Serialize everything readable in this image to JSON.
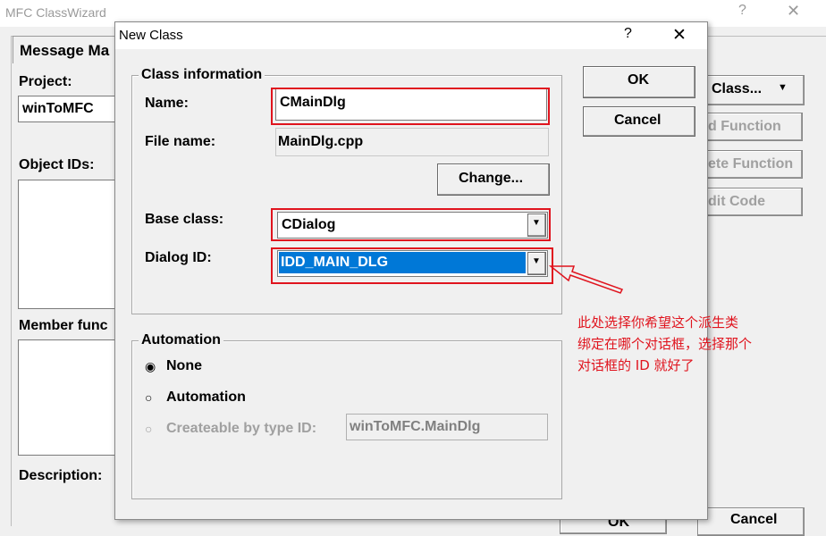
{
  "background_window": {
    "title": "MFC ClassWizard",
    "help_icon": "?",
    "close_icon": "✕",
    "tab_label": "Message Ma",
    "project_label": "Project:",
    "project_value": "winToMFC",
    "object_ids_label": "Object IDs:",
    "member_functions_label": "Member func",
    "description_label": "Description:",
    "buttons": {
      "class": "Class...",
      "add_function": "d Function",
      "delete_function": "ete Function",
      "edit_code": "dit Code",
      "ok": "OK",
      "cancel": "Cancel"
    }
  },
  "dialog": {
    "title": "New Class",
    "help_icon": "?",
    "close_icon": "✕",
    "class_information": {
      "group_label": "Class information",
      "name_label": "Name:",
      "name_value": "CMainDlg",
      "file_name_label": "File name:",
      "file_name_value": "MainDlg.cpp",
      "change_button": "Change...",
      "base_class_label": "Base class:",
      "base_class_value": "CDialog",
      "dialog_id_label": "Dialog ID:",
      "dialog_id_value": "IDD_MAIN_DLG"
    },
    "automation": {
      "group_label": "Automation",
      "options": [
        "None",
        "Automation",
        "Createable by type ID:"
      ],
      "selected": "None",
      "type_id_value": "winToMFC.MainDlg"
    },
    "ok_button": "OK",
    "cancel_button": "Cancel"
  },
  "annotation": {
    "lines": [
      "此处选择你希望这个派生类",
      "绑定在哪个对话框，选择那个",
      "对话框的 ID 就好了"
    ],
    "color": "#e0141e"
  },
  "colors": {
    "highlight": "#0078d7",
    "annotation_red": "#e0141e"
  }
}
